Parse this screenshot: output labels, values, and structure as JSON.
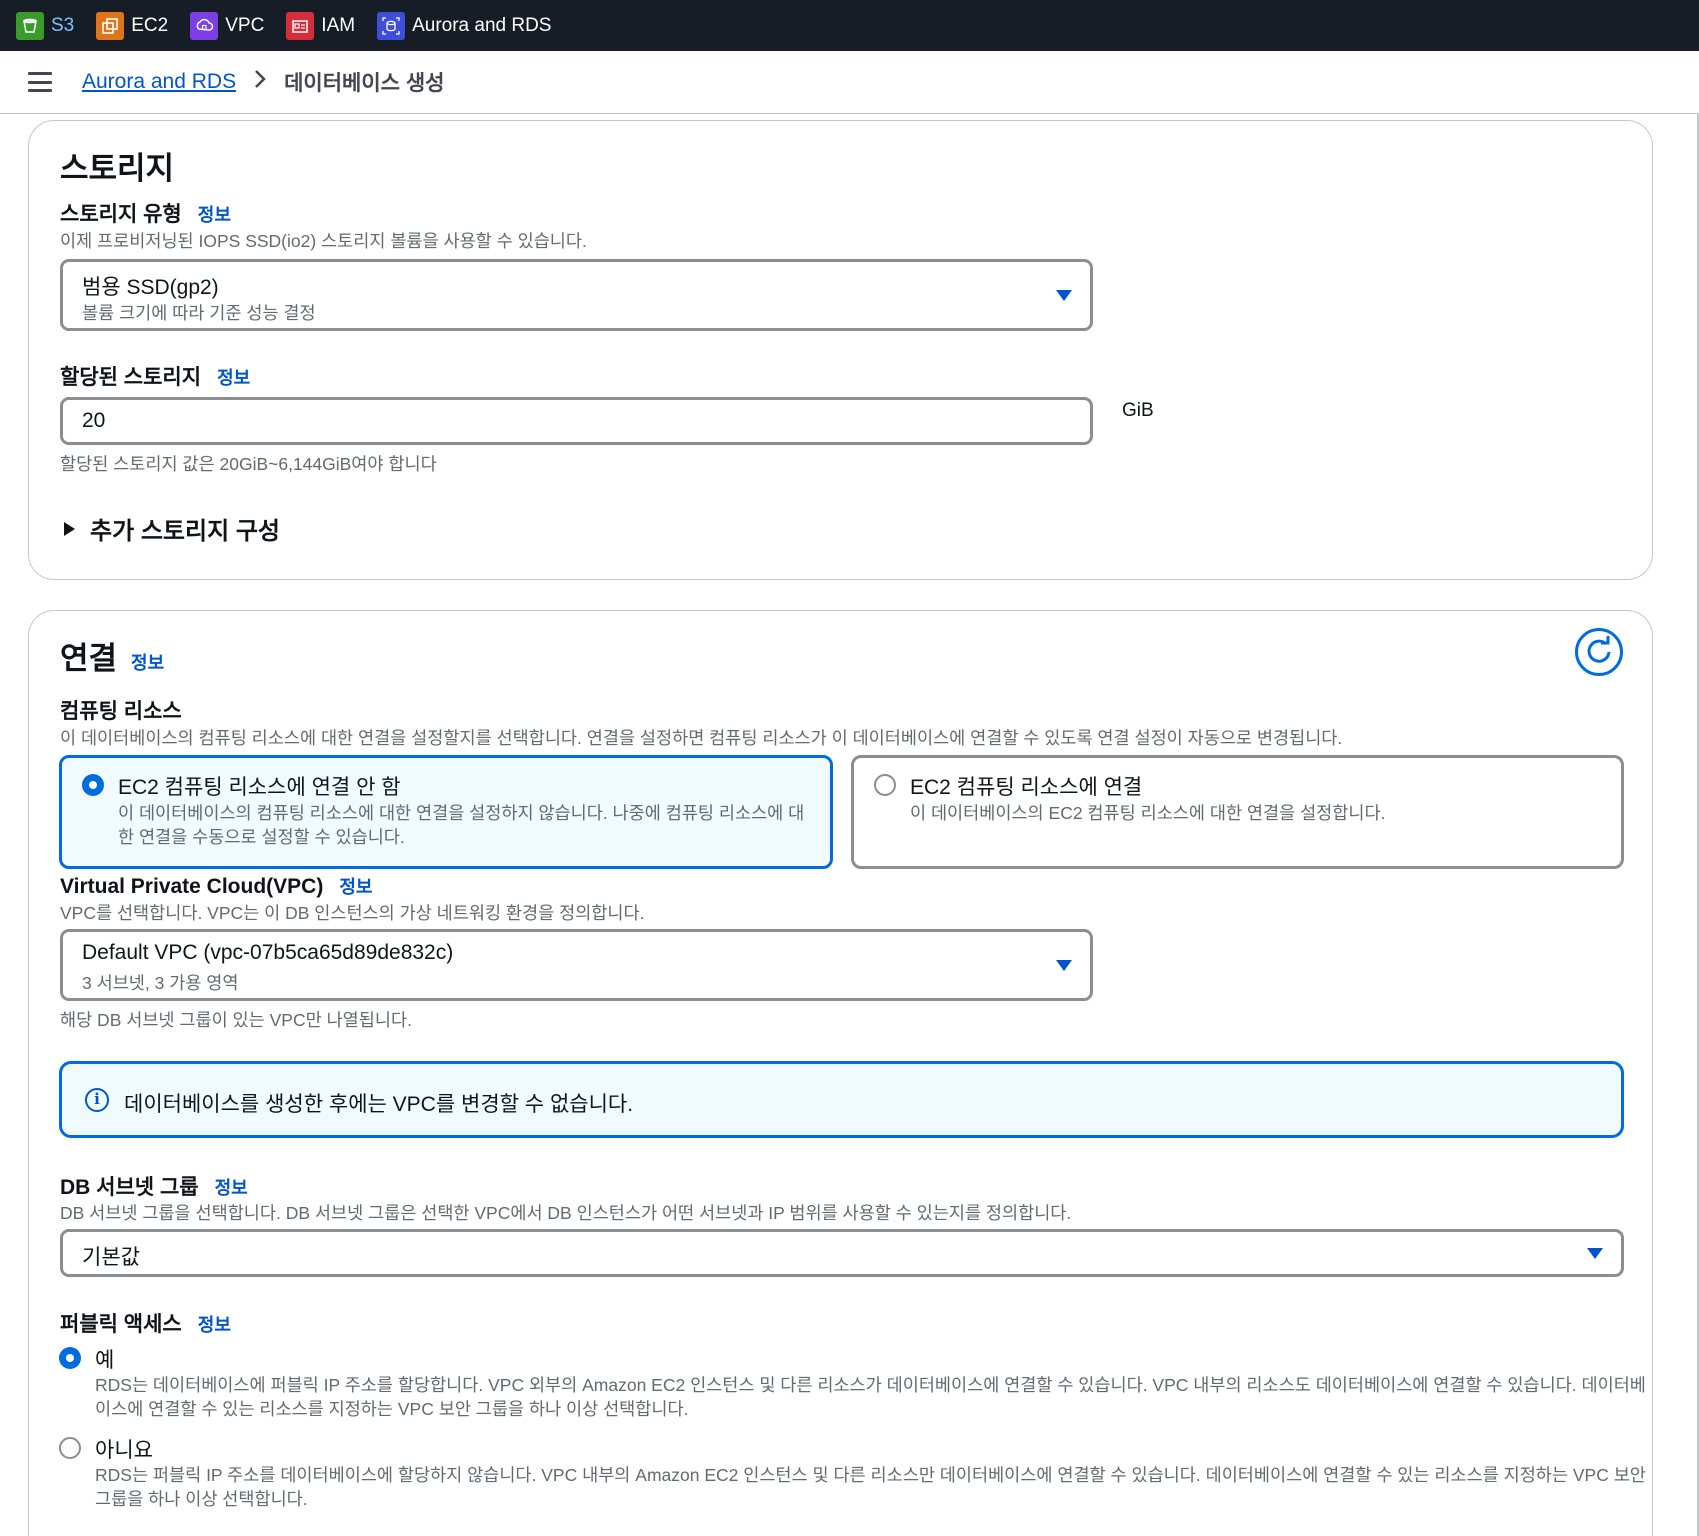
{
  "topbar": {
    "services": [
      {
        "label": "S3",
        "icon": "s3-icon",
        "color": "#3b9a2b",
        "active": true
      },
      {
        "label": "EC2",
        "icon": "ec2-icon",
        "color": "#e0741a"
      },
      {
        "label": "VPC",
        "icon": "vpc-icon",
        "color": "#7b3fe4"
      },
      {
        "label": "IAM",
        "icon": "iam-icon",
        "color": "#d42e3a"
      },
      {
        "label": "Aurora and RDS",
        "icon": "rds-icon",
        "color": "#3f4ed8"
      }
    ]
  },
  "breadcrumb": {
    "parent": "Aurora and RDS",
    "current": "데이터베이스 생성"
  },
  "storage": {
    "heading": "스토리지",
    "type_label": "스토리지 유형",
    "type_info": "정보",
    "type_desc": "이제 프로비저닝된 IOPS SSD(io2) 스토리지 볼륨을 사용할 수 있습니다.",
    "type_value": "범용 SSD(gp2)",
    "type_value_desc": "볼륨 크기에 따라 기준 성능 결정",
    "alloc_label": "할당된 스토리지",
    "alloc_info": "정보",
    "alloc_value": "20",
    "alloc_unit": "GiB",
    "alloc_hint": "할당된 스토리지 값은 20GiB~6,144GiB여야 합니다",
    "extra": "추가 스토리지 구성"
  },
  "connectivity": {
    "heading": "연결",
    "heading_info": "정보",
    "compute_label": "컴퓨팅 리소스",
    "compute_desc": "이 데이터베이스의 컴퓨팅 리소스에 대한 연결을 설정할지를 선택합니다. 연결을 설정하면 컴퓨팅 리소스가 이 데이터베이스에 연결할 수 있도록 연결 설정이 자동으로 변경됩니다.",
    "option_no_title": "EC2 컴퓨팅 리소스에 연결 안 함",
    "option_no_desc": "이 데이터베이스의 컴퓨팅 리소스에 대한 연결을 설정하지 않습니다. 나중에 컴퓨팅 리소스에 대한 연결을 수동으로 설정할 수 있습니다.",
    "option_yes_title": "EC2 컴퓨팅 리소스에 연결",
    "option_yes_desc": "이 데이터베이스의 EC2 컴퓨팅 리소스에 대한 연결을 설정합니다.",
    "vpc_label": "Virtual Private Cloud(VPC)",
    "vpc_info": "정보",
    "vpc_desc": "VPC를 선택합니다. VPC는 이 DB 인스턴스의 가상 네트워킹 환경을 정의합니다.",
    "vpc_value": "Default VPC (vpc-07b5ca65d89de832c)",
    "vpc_value_desc": "3 서브넷, 3 가용 영역",
    "vpc_hint": "해당 DB 서브넷 그룹이 있는 VPC만 나열됩니다.",
    "alert_text": "데이터베이스를 생성한 후에는 VPC를 변경할 수 없습니다.",
    "subnet_label": "DB 서브넷 그룹",
    "subnet_info": "정보",
    "subnet_desc": "DB 서브넷 그룹을 선택합니다. DB 서브넷 그룹은 선택한 VPC에서 DB 인스턴스가 어떤 서브넷과 IP 범위를 사용할 수 있는지를 정의합니다.",
    "subnet_value": "기본값",
    "public_label": "퍼블릭 액세스",
    "public_info": "정보",
    "public_yes": "예",
    "public_yes_desc": "RDS는 데이터베이스에 퍼블릭 IP 주소를 할당합니다. VPC 외부의 Amazon EC2 인스턴스 및 다른 리소스가 데이터베이스에 연결할 수 있습니다. VPC 내부의 리소스도 데이터베이스에 연결할 수 있습니다. 데이터베이스에 연결할 수 있는 리소스를 지정하는 VPC 보안 그룹을 하나 이상 선택합니다.",
    "public_no": "아니요",
    "public_no_desc": "RDS는 퍼블릭 IP 주소를 데이터베이스에 할당하지 않습니다. VPC 내부의 Amazon EC2 인스턴스 및 다른 리소스만 데이터베이스에 연결할 수 있습니다. 데이터베이스에 연결할 수 있는 리소스를 지정하는 VPC 보안 그룹을 하나 이상 선택합니다."
  }
}
